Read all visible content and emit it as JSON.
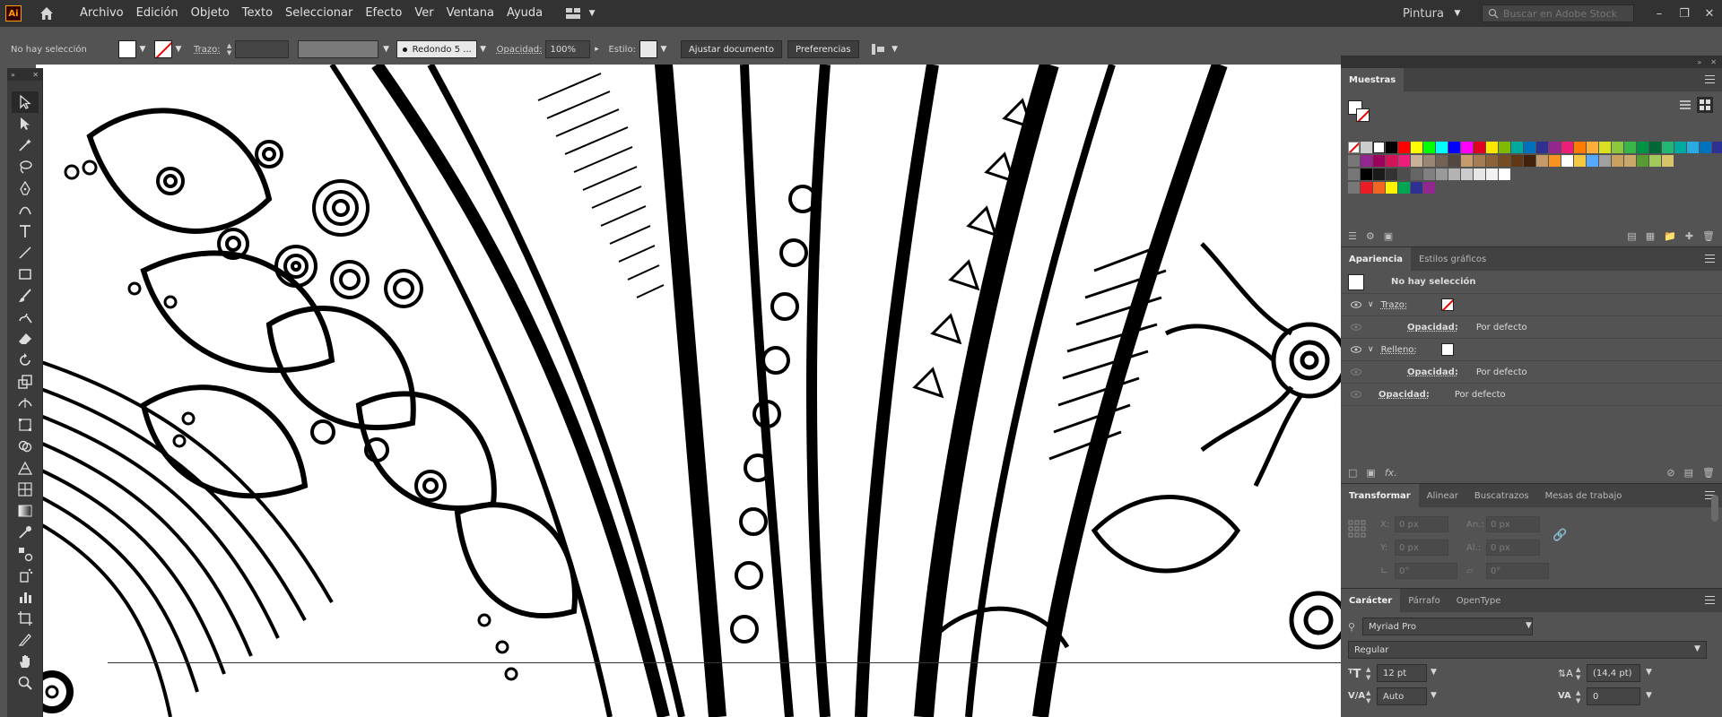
{
  "app": {
    "logo": "Ai",
    "menu": [
      "Archivo",
      "Edición",
      "Objeto",
      "Texto",
      "Seleccionar",
      "Efecto",
      "Ver",
      "Ventana",
      "Ayuda"
    ],
    "workspace": "Pintura",
    "stock_search_placeholder": "Buscar en Adobe Stock"
  },
  "control_bar": {
    "selection": "No hay selección",
    "stroke_label": "Trazo:",
    "brush": "Redondo 5 ...",
    "opacity_label": "Opacidad:",
    "opacity_value": "100%",
    "style_label": "Estilo:",
    "fit_button": "Ajustar documento",
    "prefs_button": "Preferencias"
  },
  "swatches_panel": {
    "title": "Muestras",
    "rows": [
      [
        "#ff0000",
        "#ffff00",
        "#00ff00",
        "#00ffff",
        "#0000ff",
        "#ff00ff",
        "#e00022",
        "#ffe600",
        "#7fba00",
        "#00a99d",
        "#0071bc",
        "#2e3192",
        "#93278f",
        "#ed1e79",
        "#ff7b00",
        "#fbb03b",
        "#d9e021",
        "#8cc63f",
        "#39b54a",
        "#009245",
        "#006837",
        "#22b573",
        "#00a99d",
        "#29abe2",
        "#0071bc",
        "#2e3192",
        "#1b1464",
        "#662d91"
      ],
      [
        "#93278f",
        "#9e005d",
        "#d4145a",
        "#ed1e79",
        "#c7b299",
        "#998675",
        "#736357",
        "#534741",
        "#c69c6d",
        "#a67c52",
        "#8c6239",
        "#754c24",
        "#603813",
        "#42210b",
        "#c59a6b",
        "#f7931e",
        "#ffffff",
        "#f5c842",
        "#55aaff",
        "#a0a0a0",
        "#c8a060",
        "#c9a86b",
        "#5a9a33",
        "#a3c85c",
        "#d8c26a"
      ],
      [
        "#000000",
        "#1a1a1a",
        "#333333",
        "#4d4d4d",
        "#666666",
        "#808080",
        "#999999",
        "#b3b3b3",
        "#cccccc",
        "#e6e6e6",
        "#f2f2f2",
        "#ffffff"
      ],
      [
        "#ed1c24",
        "#f26522",
        "#fff200",
        "#00a651",
        "#2e3192",
        "#92278f"
      ]
    ]
  },
  "appearance_panel": {
    "tabs": [
      "Apariencia",
      "Estilos gráficos"
    ],
    "header": "No hay selección",
    "rows": [
      {
        "label": "Trazo:",
        "value": ""
      },
      {
        "label": "Opacidad:",
        "value": "Por defecto"
      },
      {
        "label": "Relleno:",
        "value": ""
      },
      {
        "label": "Opacidad:",
        "value": "Por defecto"
      },
      {
        "label": "Opacidad:",
        "value": "Por defecto"
      }
    ]
  },
  "transform_panel": {
    "tabs": [
      "Transformar",
      "Alinear",
      "Buscatrazos",
      "Mesas de trabajo"
    ],
    "x_label": "X:",
    "x_value": "0 px",
    "y_label": "Y:",
    "y_value": "0 px",
    "w_label": "An.:",
    "w_value": "0 px",
    "h_label": "Al.:",
    "h_value": "0 px",
    "angle_value": "0°",
    "shear_value": "0°"
  },
  "character_panel": {
    "tabs": [
      "Carácter",
      "Párrafo",
      "OpenType"
    ],
    "font": "Myriad Pro",
    "style": "Regular",
    "size": "12 pt",
    "leading": "(14,4 pt)",
    "kerning": "Auto",
    "tracking": "0"
  }
}
